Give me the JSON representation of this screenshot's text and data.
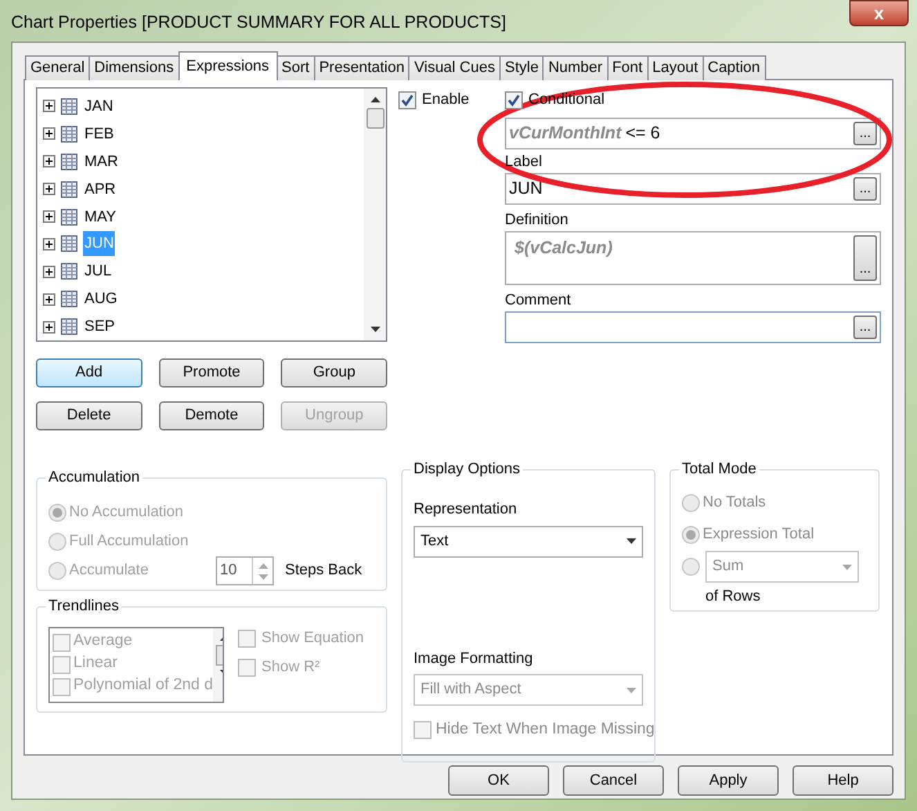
{
  "window": {
    "title": "Chart Properties [PRODUCT SUMMARY FOR ALL PRODUCTS]",
    "close": "x"
  },
  "tabs": [
    {
      "label": "General",
      "selected": false
    },
    {
      "label": "Dimensions",
      "selected": false
    },
    {
      "label": "Expressions",
      "selected": true
    },
    {
      "label": "Sort",
      "selected": false
    },
    {
      "label": "Presentation",
      "selected": false
    },
    {
      "label": "Visual Cues",
      "selected": false
    },
    {
      "label": "Style",
      "selected": false
    },
    {
      "label": "Number",
      "selected": false
    },
    {
      "label": "Font",
      "selected": false
    },
    {
      "label": "Layout",
      "selected": false
    },
    {
      "label": "Caption",
      "selected": false
    }
  ],
  "expressions": [
    {
      "label": "JAN",
      "selected": false,
      "expanded": false
    },
    {
      "label": "FEB",
      "selected": false,
      "expanded": false
    },
    {
      "label": "MAR",
      "selected": false,
      "expanded": false
    },
    {
      "label": "APR",
      "selected": false,
      "expanded": false
    },
    {
      "label": "MAY",
      "selected": false,
      "expanded": false
    },
    {
      "label": "JUN",
      "selected": true,
      "expanded": false
    },
    {
      "label": "JUL",
      "selected": false,
      "expanded": false
    },
    {
      "label": "AUG",
      "selected": false,
      "expanded": false
    },
    {
      "label": "SEP",
      "selected": false,
      "expanded": false
    }
  ],
  "list_buttons": [
    {
      "label": "Add",
      "disabled": false,
      "default": true
    },
    {
      "label": "Promote",
      "disabled": false,
      "default": false
    },
    {
      "label": "Group",
      "disabled": false,
      "default": false
    },
    {
      "label": "Delete",
      "disabled": false,
      "default": false
    },
    {
      "label": "Demote",
      "disabled": false,
      "default": false
    },
    {
      "label": "Ungroup",
      "disabled": true,
      "default": false
    }
  ],
  "enable": {
    "label": "Enable",
    "checked": true
  },
  "conditional": {
    "label": "Conditional",
    "checked": true,
    "variable": "vCurMonthInt",
    "rest": "<= 6",
    "button": "..."
  },
  "label_field": {
    "label": "Label",
    "value": "JUN",
    "button": "..."
  },
  "definition": {
    "label": "Definition",
    "value": "$(vCalcJun)",
    "button": "..."
  },
  "comment": {
    "label": "Comment",
    "button": "..."
  },
  "accumulation": {
    "title": "Accumulation",
    "options": [
      {
        "label": "No Accumulation",
        "selected": true,
        "disabled": true
      },
      {
        "label": "Full Accumulation",
        "selected": false,
        "disabled": true
      },
      {
        "label": "Accumulate",
        "selected": false,
        "disabled": true
      }
    ],
    "steps": "10",
    "steps_label": "Steps Back"
  },
  "trendlines": {
    "title": "Trendlines",
    "items": [
      {
        "label": "Average",
        "checked": false
      },
      {
        "label": "Linear",
        "checked": false
      },
      {
        "label": "Polynomial of 2nd d",
        "checked": false
      }
    ],
    "options": [
      {
        "label": "Show Equation",
        "checked": false
      },
      {
        "label": "Show R²",
        "checked": false
      }
    ]
  },
  "display_options": {
    "title": "Display Options",
    "representation_label": "Representation",
    "representation": "Text",
    "image_formatting_label": "Image Formatting",
    "image_formatting": "Fill with Aspect",
    "hide_text": {
      "label": "Hide Text When Image Missing",
      "checked": false
    }
  },
  "total_mode": {
    "title": "Total Mode",
    "options": [
      {
        "label": "No Totals",
        "selected": false,
        "disabled": true
      },
      {
        "label": "Expression Total",
        "selected": true,
        "disabled": true
      },
      {
        "selected": false,
        "disabled": true
      }
    ],
    "function": "Sum",
    "of_rows": "of Rows"
  },
  "dialog_buttons": [
    {
      "label": "OK"
    },
    {
      "label": "Cancel"
    },
    {
      "label": "Apply"
    },
    {
      "label": "Help"
    }
  ]
}
